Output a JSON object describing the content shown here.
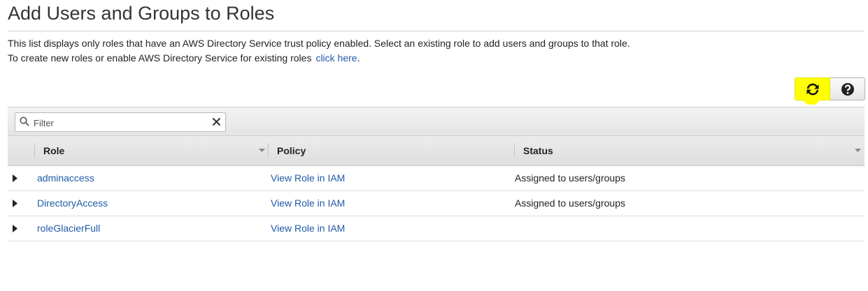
{
  "page": {
    "title": "Add Users and Groups to Roles",
    "description_line1": "This list displays only roles that have an AWS Directory Service trust policy enabled. Select an existing role to add users and groups to that role.",
    "description_line2": "To create new roles or enable AWS Directory Service for existing roles",
    "link_text": "click here",
    "link_suffix": "."
  },
  "toolbar": {
    "refresh_icon": "refresh-icon",
    "help_icon": "help-icon",
    "highlight_color": "#ffff00"
  },
  "filter": {
    "placeholder": "Filter",
    "value": ""
  },
  "table": {
    "columns": [
      "Role",
      "Policy",
      "Status"
    ],
    "rows": [
      {
        "role": "adminaccess",
        "policy": "View Role in IAM",
        "status": "Assigned to users/groups"
      },
      {
        "role": "DirectoryAccess",
        "policy": "View Role in IAM",
        "status": "Assigned to users/groups"
      },
      {
        "role": "roleGlacierFull",
        "policy": "View Role in IAM",
        "status": ""
      }
    ]
  },
  "colors": {
    "link": "#1f5ba8",
    "header_bg": "#e4e4e4"
  }
}
